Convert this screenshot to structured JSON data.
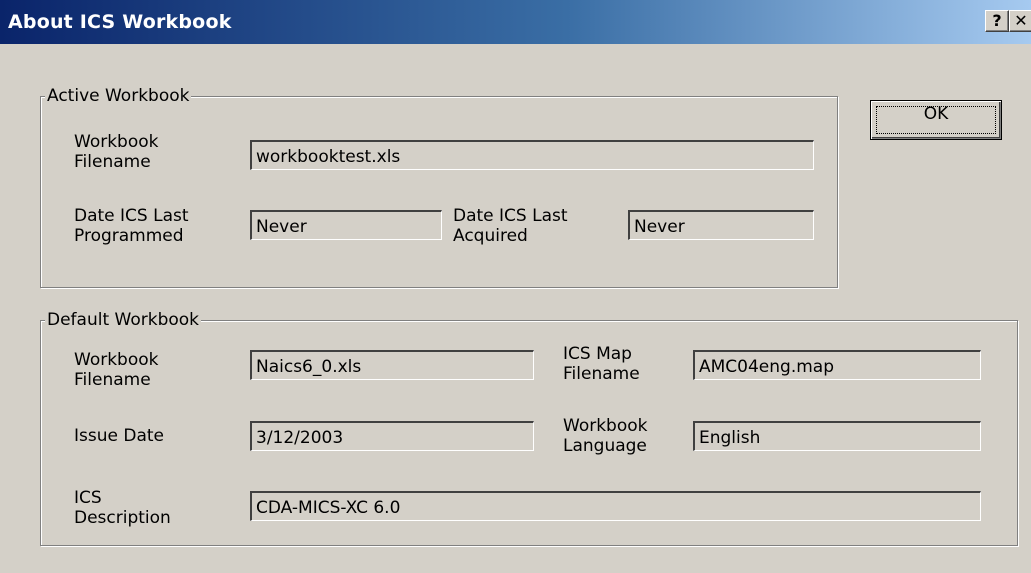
{
  "window": {
    "title": "About ICS Workbook",
    "help_label": "?",
    "close_label": "✕"
  },
  "active_group": {
    "legend": "Active Workbook",
    "filename_label_1": "Workbook",
    "filename_label_2": "Filename",
    "filename_value": "workbooktest.xls",
    "programmed_label_1": "Date ICS Last",
    "programmed_label_2": "Programmed",
    "programmed_value": "Never",
    "acquired_label_1": "Date ICS Last",
    "acquired_label_2": "Acquired",
    "acquired_value": "Never"
  },
  "default_group": {
    "legend": "Default Workbook",
    "filename_label_1": "Workbook",
    "filename_label_2": "Filename",
    "filename_value": "Naics6_0.xls",
    "map_label_1": "ICS Map",
    "map_label_2": "Filename",
    "map_value": "AMC04eng.map",
    "issue_label": "Issue Date",
    "issue_value": "3/12/2003",
    "language_label_1": "Workbook",
    "language_label_2": "Language",
    "language_value": "English",
    "description_label_1": "ICS",
    "description_label_2": "Description",
    "description_value": "CDA-MICS-XC 6.0"
  },
  "buttons": {
    "ok_label": "OK"
  }
}
